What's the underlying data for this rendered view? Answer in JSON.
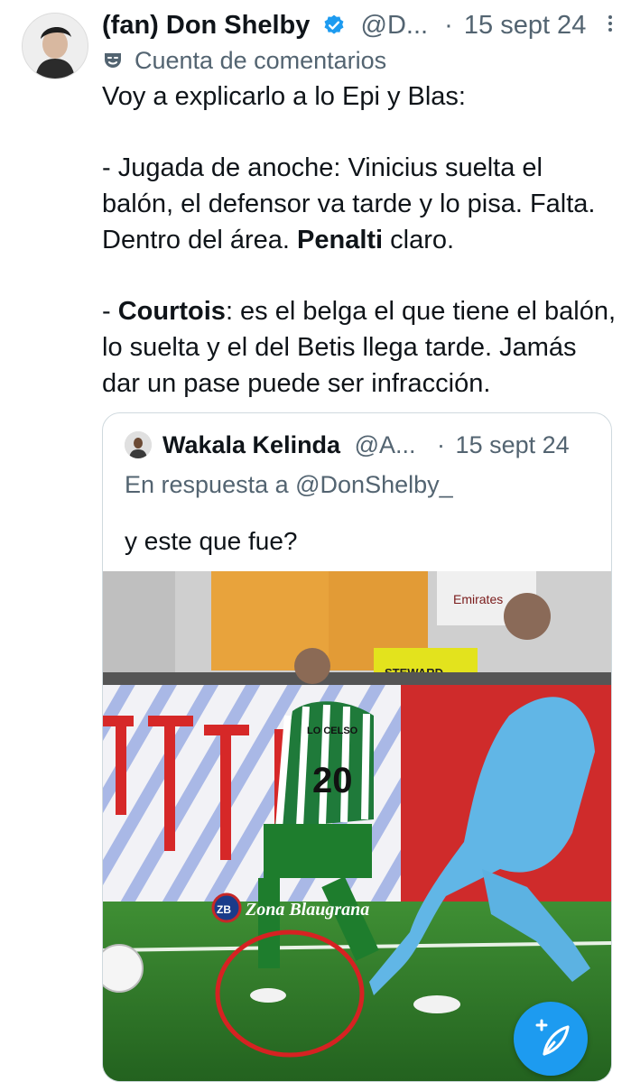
{
  "tweet": {
    "author_name": "(fan) Don Shelby",
    "handle": "@D...",
    "separator": "·",
    "date": "15 sept 24",
    "account_label": "Cuenta de comentarios",
    "paragraphs": {
      "p1": "Voy a explicarlo a lo Epi y Blas:",
      "p2a": "- Jugada de anoche: Vinicius suelta el balón, el defensor va tarde y lo pisa. Falta. Dentro del área. ",
      "p2b": "Penalti",
      "p2c": " claro.",
      "p3a": "- ",
      "p3b": "Courtois",
      "p3c": ": es el belga el que tiene el balón, lo suelta y el del Betis llega tarde. Jamás dar un pase puede ser infracción."
    }
  },
  "quote": {
    "author_name": "Wakala Kelinda",
    "handle": "@A...",
    "separator": "·",
    "date": "15 sept 24",
    "reply_prefix": "En respuesta a ",
    "reply_mention": "@DonShelby_",
    "text": "y este que fue?",
    "media": {
      "ad_text": "Emirates",
      "steward_text": "STEWARD",
      "jersey_number": "20",
      "jersey_name": "LO CELSO",
      "watermark_badge": "ZB",
      "watermark_text": "Zona Blaugrana"
    }
  },
  "fab": {
    "icon": "compose-icon"
  },
  "colors": {
    "accent": "#1d9bf0",
    "muted": "#536471",
    "text": "#0f1419"
  }
}
